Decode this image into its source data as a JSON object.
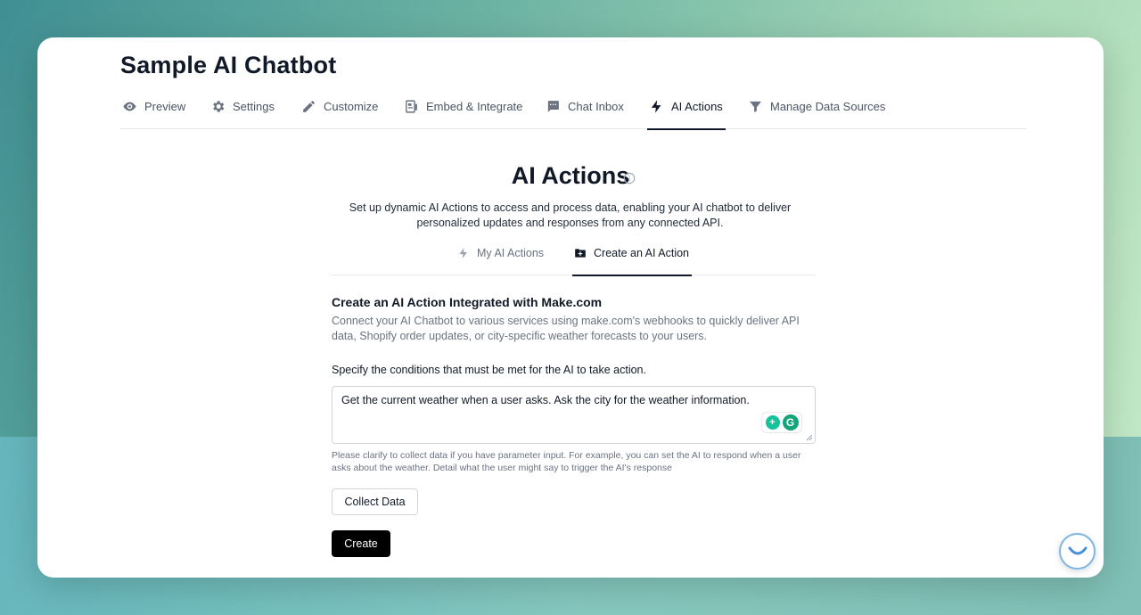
{
  "app": {
    "title": "Sample AI Chatbot"
  },
  "nav": {
    "items": [
      {
        "label": "Preview",
        "icon": "eye-icon"
      },
      {
        "label": "Settings",
        "icon": "gear-icon"
      },
      {
        "label": "Customize",
        "icon": "pencil-icon"
      },
      {
        "label": "Embed & Integrate",
        "icon": "document-icon"
      },
      {
        "label": "Chat Inbox",
        "icon": "chat-bubble-icon"
      },
      {
        "label": "AI Actions",
        "icon": "lightning-icon",
        "active": true
      },
      {
        "label": "Manage Data Sources",
        "icon": "funnel-icon"
      }
    ]
  },
  "section": {
    "title": "AI Actions",
    "description": "Set up dynamic AI Actions to access and process data, enabling your AI chatbot to deliver personalized updates and responses from any connected API."
  },
  "subtabs": [
    {
      "label": "My AI Actions",
      "icon": "lightning-icon"
    },
    {
      "label": "Create an AI Action",
      "icon": "folder-plus-icon",
      "active": true
    }
  ],
  "form": {
    "heading": "Create an AI Action Integrated with Make.com",
    "description": "Connect your AI Chatbot to various services using make.com's webhooks to quickly deliver API data, Shopify order updates, or city-specific weather forecasts to your users.",
    "condition_label": "Specify the conditions that must be met for the AI to take action.",
    "condition_value": "Get the current weather when a user asks. Ask the city for the weather information.",
    "hint": "Please clarify to collect data if you have parameter input. For example, you can set the AI to respond when a user asks about the weather. Detail what the user might say to trigger the AI's response",
    "collect_label": "Collect Data",
    "create_label": "Create"
  },
  "colors": {
    "accent": "#111827",
    "primary_button": "#000000",
    "grammarly": "#15c39a"
  }
}
